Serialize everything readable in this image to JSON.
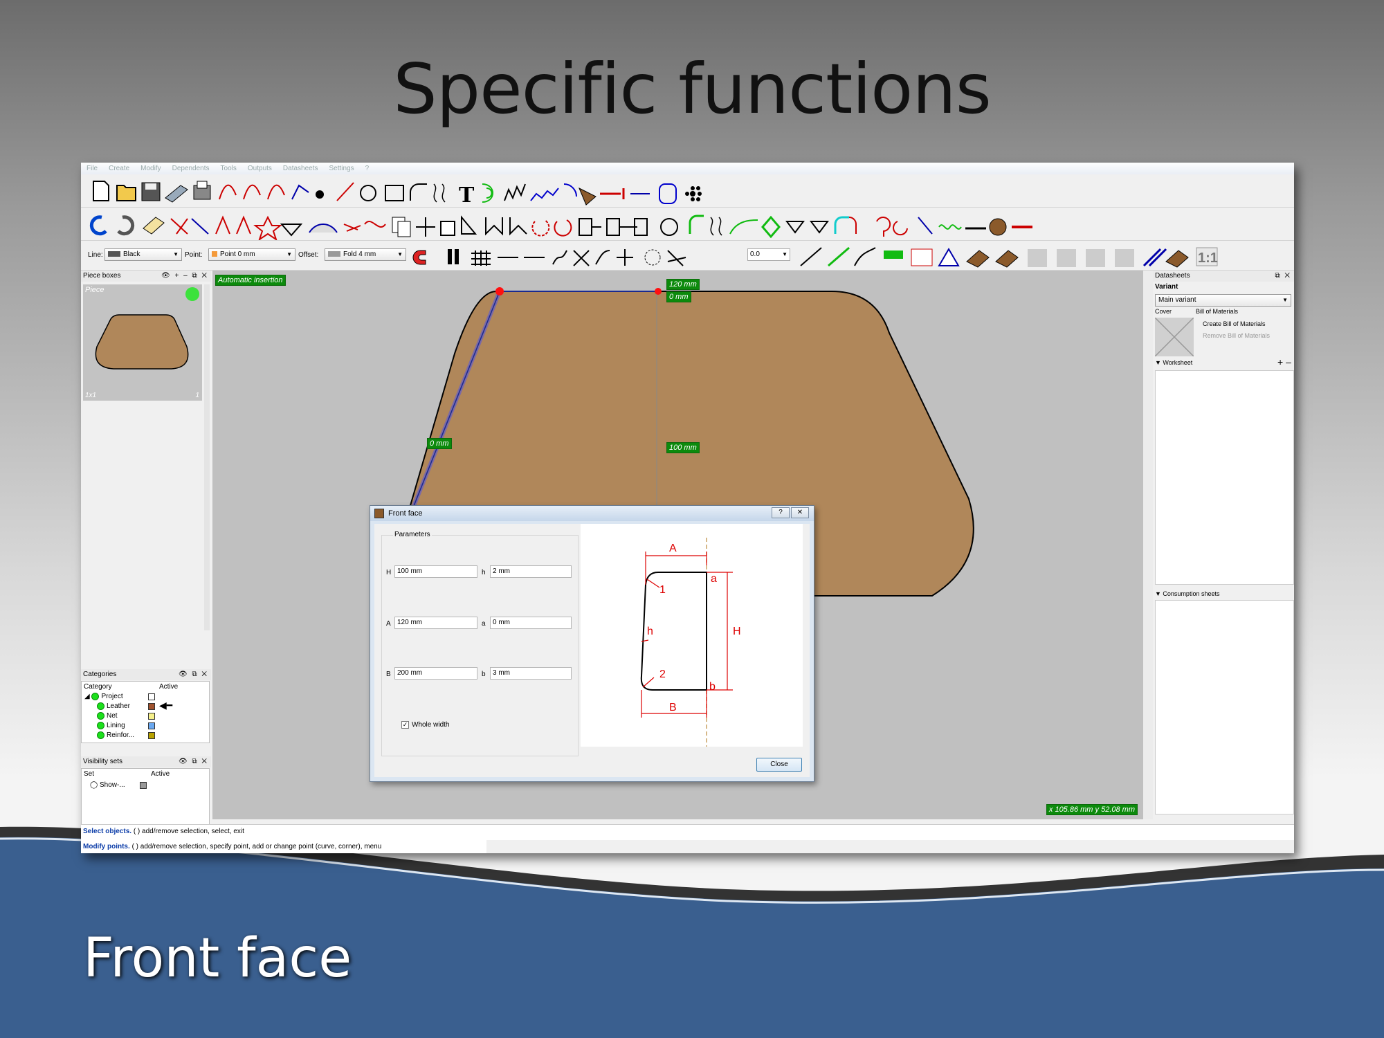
{
  "slide": {
    "title": "Specific functions",
    "caption": "Front face"
  },
  "menu": [
    "File",
    "Create",
    "Modify",
    "Dependents",
    "Tools",
    "Outputs",
    "Datasheets",
    "Settings",
    "?"
  ],
  "toolbar": {
    "line_label": "Line:",
    "line_value": "Black",
    "point_label": "Point:",
    "point_value": "Point 0 mm",
    "offset_label": "Offset:",
    "offset_value": "Fold 4 mm",
    "spin_value": "0.0",
    "ratio_label": "1:1"
  },
  "piece_boxes": {
    "title": "Piece boxes",
    "piece_name": "Piece",
    "scale": "1x1",
    "count": "1"
  },
  "categories": {
    "title": "Categories",
    "col_category": "Category",
    "col_active": "Active",
    "items": [
      {
        "label": "Project",
        "color": "#ffffff"
      },
      {
        "label": "Leather",
        "color": "#a0522d"
      },
      {
        "label": "Net",
        "color": "#f6f08a"
      },
      {
        "label": "Lining",
        "color": "#6aa8f0"
      },
      {
        "label": "Reinfor...",
        "color": "#b8a200"
      }
    ]
  },
  "visibility_sets": {
    "title": "Visibility sets",
    "col_set": "Set",
    "col_active": "Active",
    "item": "Show-..."
  },
  "canvas": {
    "auto_insert": "Automatic insertion",
    "dim_top": "120 mm",
    "dim_top_small": "0 mm",
    "dim_left": "0 mm",
    "dim_center": "100 mm",
    "coords": "x 105.86 mm  y 52.08 mm"
  },
  "datasheets": {
    "title": "Datasheets",
    "variant_label": "Variant",
    "variant_value": "Main variant",
    "cover_label": "Cover",
    "bom_label": "Bill of Materials",
    "create_bom": "Create Bill of Materials",
    "remove_bom": "Remove Bill of Materials",
    "worksheet": "Worksheet",
    "consumption": "Consumption sheets"
  },
  "status": {
    "row1_bold": "Select objects.",
    "row1_text": "( ) add/remove selection,   select,   exit",
    "row2_bold": "Modify points.",
    "row2_text": "( ) add/remove selection,   specify point,   add or change point (curve, corner),   menu"
  },
  "dialog": {
    "title": "Front face",
    "help": "?",
    "close_x": "✕",
    "group_title": "Parameters",
    "params": [
      {
        "name": "H",
        "value": "100 mm",
        "name2": "h",
        "value2": "2 mm"
      },
      {
        "name": "A",
        "value": "120 mm",
        "name2": "a",
        "value2": "0 mm"
      },
      {
        "name": "B",
        "value": "200 mm",
        "name2": "b",
        "value2": "3 mm"
      }
    ],
    "whole_width": "Whole width",
    "close_button": "Close",
    "diagram_labels": {
      "A": "A",
      "a": "a",
      "one": "1",
      "h": "h",
      "H": "H",
      "two": "2",
      "b": "b",
      "B": "B"
    }
  }
}
